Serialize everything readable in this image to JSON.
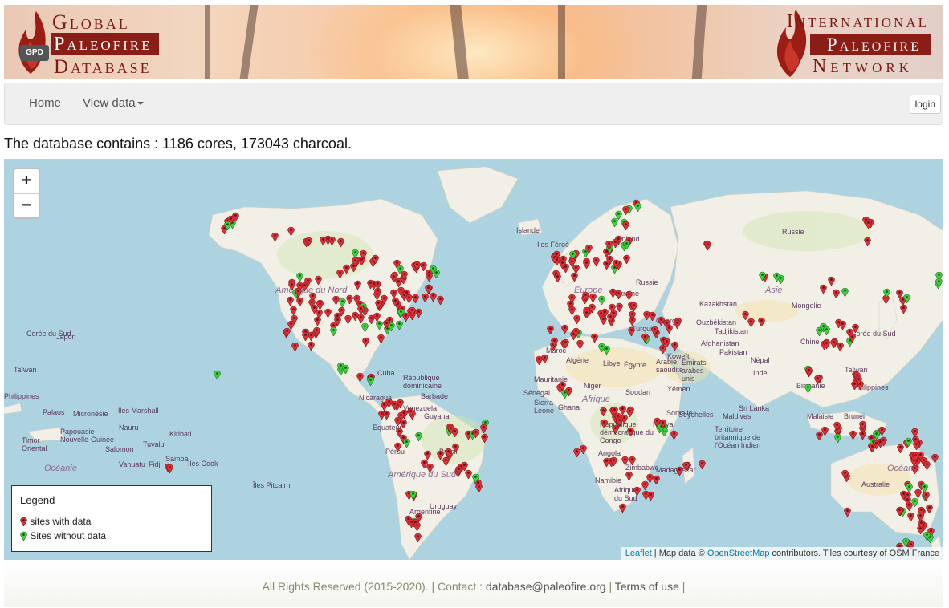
{
  "header": {
    "left_logo": {
      "line1": "Global",
      "line2": "Paleofire",
      "line3": "Database",
      "badge": "GPD"
    },
    "right_logo": {
      "line1": "International",
      "line2": "Paleofire",
      "line3": "Network"
    }
  },
  "navbar": {
    "home_label": "Home",
    "view_data_label": "View data",
    "login_label": "login"
  },
  "headline": "The database contains : 1186 cores, 173043 charcoal.",
  "map": {
    "zoom_in": "+",
    "zoom_out": "−",
    "labels": {
      "amerique_du_nord": "Amérique du Nord",
      "amerique_du_sud": "Amérique du Sud",
      "europe": "Europe",
      "afrique": "Afrique",
      "asie": "Asie",
      "oceanie_left": "Océanie",
      "oceanie_right": "Océanie",
      "russie": "Russie",
      "islande": "Islande",
      "iles_feroe": "Îles Féroé",
      "finland": "Finland",
      "kazakhstan": "Kazakhstan",
      "mongolie": "Mongolie",
      "chine": "Chine",
      "coree_du_sud_left": "Corée du Sud",
      "coree_du_sud_right": "Corée du Sud",
      "japon": "Japon",
      "taiwan_left": "Taïwan",
      "taiwan_right": "Taïwan",
      "philippines_left": "Philippines",
      "philippines_right": "Philippines",
      "micronesie": "Micronésie",
      "palaos": "Palaos",
      "iles_marshall": "Îles Marshall",
      "nauru": "Nauru",
      "kiribati": "Kiribati",
      "papouasie": "Papouasie-Nouvelle-Guinée",
      "salomon": "Salomon",
      "tuvalu": "Tuvalu",
      "samoa": "Samoa",
      "vanuatu": "Vanuatu",
      "fidji": "Fidji",
      "iles_cook": "Îles Cook",
      "iles_pitcairn": "Îles Pitcairn",
      "timor": "Timor Oriental",
      "cuba": "Cuba",
      "republique_dom": "République dominicaine",
      "nicaragua": "Nicaragua",
      "barbade": "Barbade",
      "venezuela": "Venezuela",
      "guyana": "Guyana",
      "equateur": "Équateur",
      "bresil": "Brésil",
      "perou": "Pérou",
      "uruguay": "Uruguay",
      "argentine": "Argentine",
      "mauritanie": "Mauritanie",
      "senegal": "Sénégal",
      "sierra_leone": "Sierra Leone",
      "ghana": "Ghana",
      "niger": "Niger",
      "soudan": "Soudan",
      "somalie": "Somalie",
      "kenya": "Kenya",
      "rdc": "République démocratique du Congo",
      "angola": "Angola",
      "namibie": "Namibie",
      "zimbabwe": "Zimbabwe",
      "madagascar": "Madagascar",
      "afrique_du_sud": "Afrique du Sud",
      "algerie": "Algérie",
      "libye": "Libye",
      "egypte": "Égypte",
      "maroc": "Maroc",
      "arabie": "Arabie saoudite",
      "emirats": "Émirats arabes unis",
      "yemen": "Yémen",
      "koweit": "Koweït",
      "turquie": "Turquie",
      "georgie": "Géorgie",
      "ouzbekistan": "Ouzbékistan",
      "tadjikistan": "Tadjikistan",
      "afghanistan": "Afghanistan",
      "pakistan": "Pakistan",
      "nepal": "Népal",
      "inde": "Inde",
      "birmanie": "Birmanie",
      "sri_lanka": "Sri Lanka",
      "maldives": "Maldives",
      "seychelles": "Seychelles",
      "territoire": "Territoire britannique de l'Océan Indien",
      "malaisie": "Malaisie",
      "brunei": "Brunei",
      "australie": "Australie",
      "ukraine": "Ukraine",
      "russie_small": "Russie"
    },
    "pin_colors": {
      "with_data": "#e0303a",
      "without_data": "#3fd23f"
    },
    "attribution": {
      "leaflet": "Leaflet",
      "map_data_prefix": " | Map data © ",
      "osm": "OpenStreetMap",
      "suffix": " contributors. Tiles courtesy of OSM France"
    }
  },
  "legend": {
    "title": "Legend",
    "with_data": "sites with data",
    "without_data": "Sites without data"
  },
  "footer": {
    "rights": "All Rights Reserved (2015-2020). | Contact : ",
    "email": "database@paleofire.org",
    "sep1": " | ",
    "terms": "Terms of use",
    "sep2": " |"
  }
}
